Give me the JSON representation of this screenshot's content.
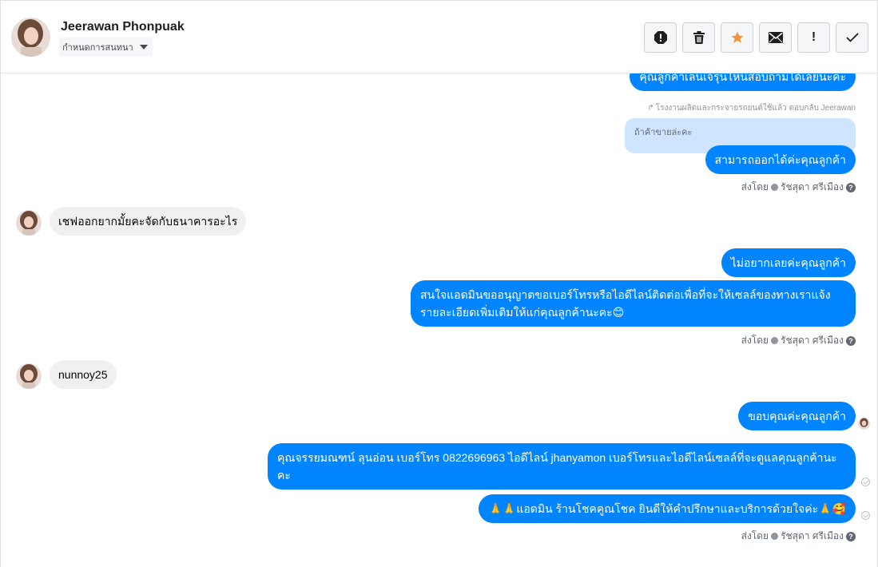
{
  "header": {
    "contact_name": "Jeerawan Phonpuak",
    "assign_label": "กำหนดการสนทนา",
    "toolbar": {
      "spam": "spam-icon",
      "delete": "trash-icon",
      "star": "star-icon",
      "mark_unread": "envelope-icon",
      "follow_up": "!",
      "done": "checkmark-icon"
    },
    "star_color": "#f7923b"
  },
  "messages": {
    "partial_top": "คุณลูกค้าเล่นเจ้รุ่นไหนสอบถามได้เลยนะคะ",
    "reply_meta": "โรงงานผลิตและกระจายรถยนต์ใช้แล้ว ตอบกลับ Jeerawan",
    "quoted": "ถ้าค้าขายล่ะคะ",
    "out_1": "สามารถออกได้ค่ะคุณลูกค้า",
    "sent_by_1_prefix": "ส่งโดย",
    "sent_by_1_name": "รัชสุดา ศรีเมือง",
    "in_1": "เชฟออกยากมั้ยคะจัดกับธนาคารอะไร",
    "out_2": "ไม่อยากเลยค่ะคุณลูกค้า",
    "out_3": "สนใจแอดมินขออนุญาตขอเบอร์โทรหรือไอดีไลน์ติดต่อเพื่อที่จะให้เซลล์ของทางเราแจ้งรายละเอียดเพิ่มเติมให้แก่คุณลูกค้านะคะ😊",
    "sent_by_2_prefix": "ส่งโดย",
    "sent_by_2_name": "รัชสุดา ศรีเมือง",
    "in_2": "nunnoy25",
    "out_4": "ขอบคุณค่ะคุณลูกค้า",
    "out_5": "คุณจรรยมณฑน์ ลุนอ่อน เบอร์โทร 0822696963  ไอดีไลน์  jhanyamon   เบอร์โทรและไอดีไลน์เซลล์ที่จะดูแลคุณลูกค้านะคะ",
    "out_6": "🙏🙏แอดมิน ร้านโชคคูณโชค ยินดีให้คำปรึกษาและบริการด้วยใจค่ะ🙏🥰",
    "sent_by_3_prefix": "ส่งโดย",
    "sent_by_3_name": "รัชสุดา ศรีเมือง",
    "help_glyph": "?"
  },
  "colors": {
    "outgoing_bubble": "#0084ff",
    "incoming_bubble": "#f0f0f0",
    "quoted_bubble": "#cfe5ff"
  }
}
